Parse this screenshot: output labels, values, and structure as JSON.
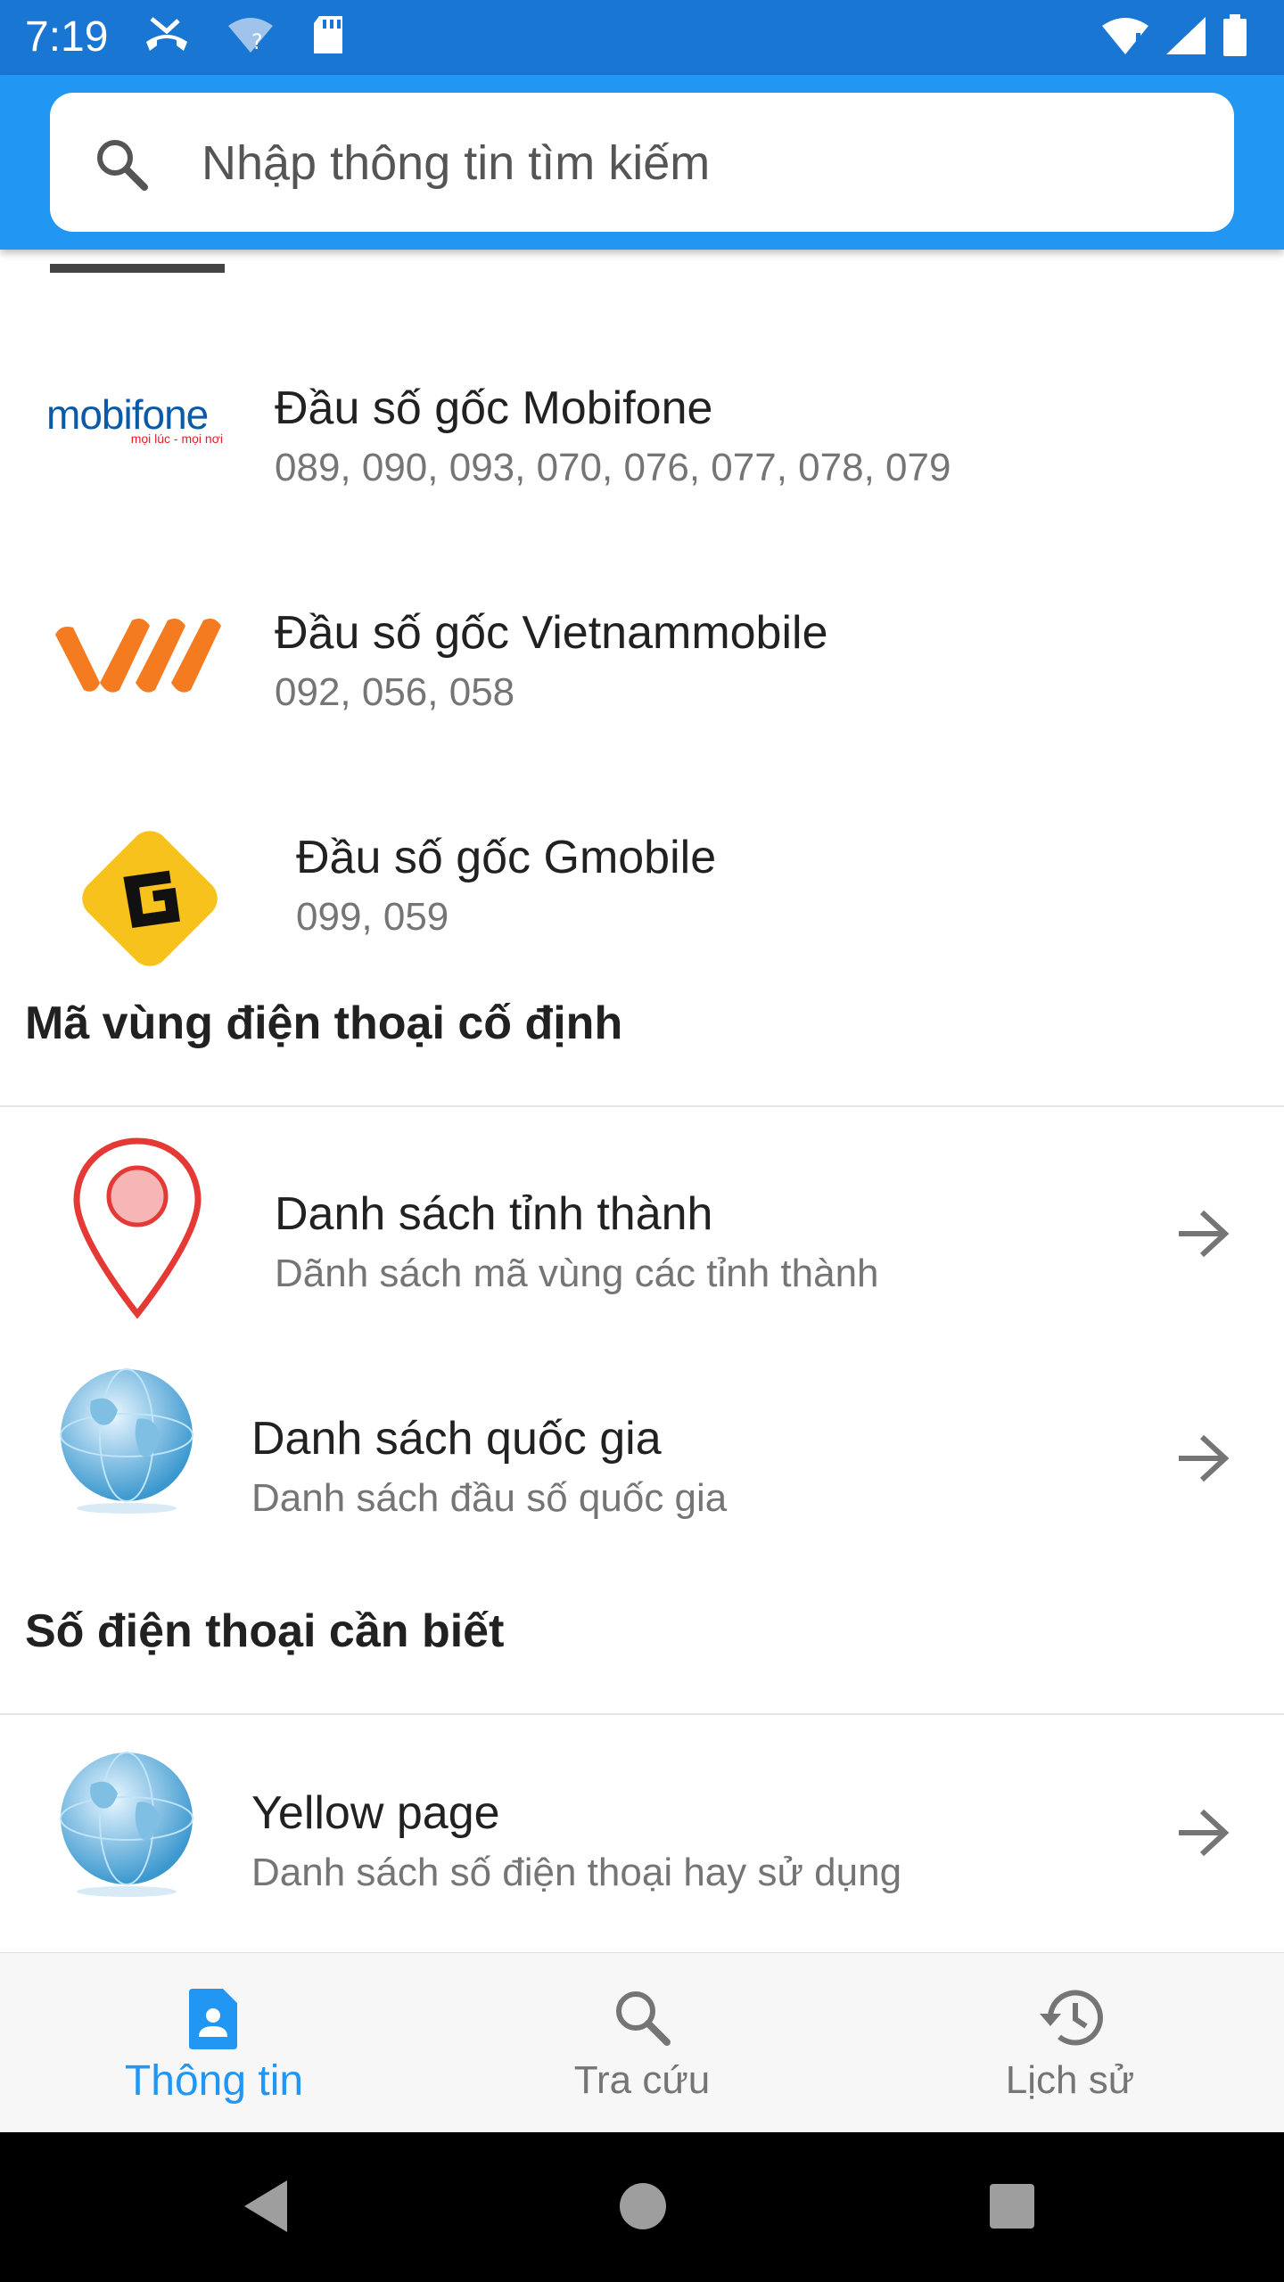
{
  "status": {
    "time": "7:19"
  },
  "search": {
    "placeholder": "Nhập thông tin tìm kiếm"
  },
  "carriers": [
    {
      "logo": "mobifone-logo",
      "logo_text": "mobifone",
      "logo_tagline": "mọi lúc - mọi nơi",
      "title": "Đầu số gốc Mobifone",
      "subtitle": "089, 090, 093, 070, 076, 077, 078, 079"
    },
    {
      "logo": "vietnammobile-logo",
      "title": "Đầu số gốc Vietnammobile",
      "subtitle": "092, 056, 058"
    },
    {
      "logo": "gmobile-logo",
      "title": "Đầu số gốc Gmobile",
      "subtitle": "099, 059"
    }
  ],
  "sections": {
    "landline": {
      "title": "Mã vùng điện thoại cố định",
      "items": [
        {
          "icon": "location-pin-icon",
          "title": "Danh sách tỉnh thành",
          "subtitle": "Dãnh sách mã vùng các tỉnh thành"
        },
        {
          "icon": "globe-icon",
          "title": "Danh sách quốc gia",
          "subtitle": "Danh sách đầu số quốc gia"
        }
      ]
    },
    "useful": {
      "title": "Số điện thoại cần biết",
      "items": [
        {
          "icon": "globe-icon",
          "title": "Yellow page",
          "subtitle": "Danh sách số điện thoại hay sử dụng"
        }
      ]
    }
  },
  "bottom_nav": [
    {
      "label": "Thông tin",
      "icon": "contact-card-icon",
      "active": true
    },
    {
      "label": "Tra cứu",
      "icon": "search-icon",
      "active": false
    },
    {
      "label": "Lịch sử",
      "icon": "history-icon",
      "active": false
    }
  ],
  "colors": {
    "primary": "#2196f3",
    "status_bar": "#1976d2",
    "mobifone_blue": "#0a5aa8",
    "mobifone_red": "#e31e24",
    "vietnammobile_orange": "#f47b20",
    "gmobile_yellow": "#f8c21c",
    "pin_red": "#e53935"
  }
}
